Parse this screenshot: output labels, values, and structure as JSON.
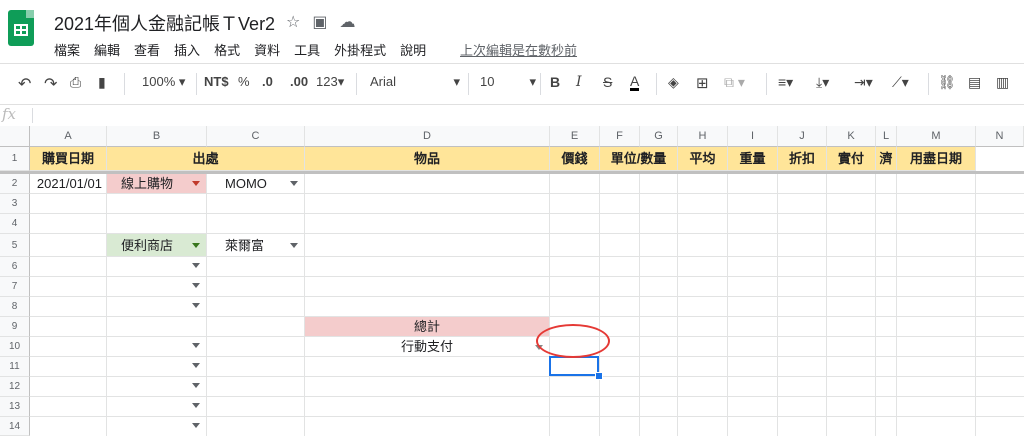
{
  "doc": {
    "title": "2021年個人金融記帳ＴVer2",
    "title_icons": [
      "star-icon",
      "move-folder-icon",
      "cloud-status-icon"
    ]
  },
  "menu": [
    "檔案",
    "編輯",
    "查看",
    "插入",
    "格式",
    "資料",
    "工具",
    "外掛程式",
    "說明"
  ],
  "last_edit": "上次編輯是在數秒前",
  "toolbar": {
    "zoom": "100%",
    "currency": "NT$",
    "percent": "%",
    "dec_less": ".0",
    "dec_more": ".00",
    "more_formats": "123",
    "font": "Arial",
    "font_size": "10",
    "bold": "B",
    "italic": "I",
    "strike": "S",
    "text_color": "A"
  },
  "formula": {
    "fx": "fx",
    "content": ""
  },
  "columns": [
    "A",
    "B",
    "C",
    "D",
    "E",
    "F",
    "G",
    "H",
    "I",
    "J",
    "K",
    "L",
    "M",
    "N"
  ],
  "rows": [
    "1",
    "2",
    "3",
    "4",
    "5",
    "6",
    "7",
    "8",
    "9",
    "10",
    "11",
    "12",
    "13",
    "14"
  ],
  "header_row": {
    "a": "購買日期",
    "bc": "出處",
    "d": "物品",
    "e": "價錢",
    "fg": "單位/數量",
    "h": "平均",
    "i": "重量",
    "j": "折扣",
    "k": "實付",
    "l": "濟",
    "m": "用盡日期"
  },
  "cells": {
    "a2": "2021/01/01",
    "b2": "線上購物",
    "c2": "MOMO",
    "b5": "便利商店",
    "c5": "萊爾富",
    "d9": "總計",
    "d10": "行動支付"
  },
  "colors": {
    "header_fill": "#ffe599",
    "pink_fill": "#f4cccc",
    "green_fill": "#d9ead3",
    "selection": "#1a73e8",
    "annotation": "#e53935",
    "logo": "#0f9d58"
  }
}
